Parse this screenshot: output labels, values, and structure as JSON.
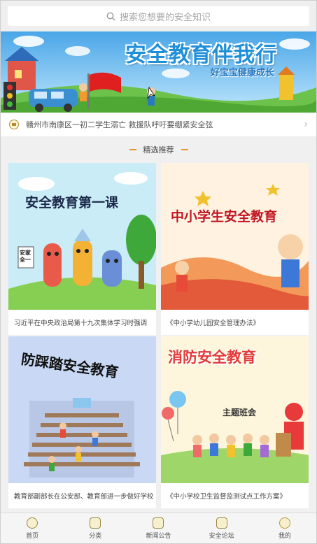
{
  "search": {
    "placeholder": "搜索您想要的安全知识"
  },
  "banner": {
    "title": "安全教育伴我行",
    "subtitle": "好宝宝健康成长"
  },
  "notice": {
    "text": "赣州市南康区一初二学生溺亡 救援队呼吁要绷紧安全弦"
  },
  "section": {
    "title": "精选推荐"
  },
  "cards": [
    {
      "image_title": "安全教育第一课",
      "sign_text": "安家全一",
      "caption": "习近平在中央政治局第十九次集体学习时强调"
    },
    {
      "image_title": "中小学生安全教育",
      "caption": "《中小学幼儿园安全管理办法》"
    },
    {
      "image_title": "防踩踏安全教育",
      "caption": "教育部副部长在公安部、教育部进一步做好学校"
    },
    {
      "image_title": "消防安全教育",
      "image_subtitle": "主题班会",
      "caption": "《中小学校卫生监督监测试点工作方案》"
    }
  ],
  "tabbar": [
    {
      "label": "首页",
      "icon": "home-icon"
    },
    {
      "label": "分类",
      "icon": "category-icon"
    },
    {
      "label": "新闻公告",
      "icon": "news-icon"
    },
    {
      "label": "安全论坛",
      "icon": "forum-icon"
    },
    {
      "label": "我的",
      "icon": "profile-icon"
    }
  ],
  "colors": {
    "accent": "#e7962d",
    "banner_title": "#1f8fd8"
  }
}
